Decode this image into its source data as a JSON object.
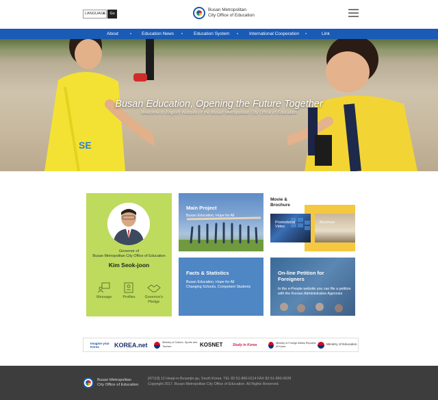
{
  "header": {
    "language_label": "LANGUAGE",
    "go_label": "Go",
    "logo_line1": "Busan Metropolitan",
    "logo_line2": "City Office of Education"
  },
  "nav": {
    "items": [
      {
        "label": "About"
      },
      {
        "label": "Education News"
      },
      {
        "label": "Education System"
      },
      {
        "label": "International Cooperation"
      },
      {
        "label": "Link"
      }
    ]
  },
  "hero": {
    "title": "Busan Education, Opening the Future Together",
    "subtitle": "Welcome to English Website of the Busan Metropolitan City Office of Education"
  },
  "governor": {
    "title_line1": "Governor of",
    "title_line2": "Busan Metropolitan City Office of Education",
    "name": "Kim Seok-joon",
    "links": [
      {
        "label": "Message",
        "icon": "message-icon"
      },
      {
        "label": "Profiles",
        "icon": "profile-icon"
      },
      {
        "label": "Governor's Pledge",
        "icon": "handshake-icon"
      }
    ]
  },
  "cards": {
    "main_project": {
      "title": "Main Project",
      "desc": "Busan Education, Hope for All"
    },
    "facts": {
      "title": "Facts & Statistics",
      "desc_line1": "Busan Education, Hope for All",
      "desc_line2": "Changing Schools, Competent Students"
    },
    "movie": {
      "title_line1": "Movie &",
      "title_line2": "Brochure",
      "promo_label": "Promotional",
      "promo_label2": "Video",
      "brochure_label": "Brochure"
    },
    "petition": {
      "title_line1": "On-line Petition for",
      "title_line2": "Foreigners",
      "desc_line1": "In the e-People website you can file a petition",
      "desc_line2": "with the Korean Administrative Agencies"
    }
  },
  "partners": [
    {
      "label": "Imagine your Korea"
    },
    {
      "label": "KOREA.net"
    },
    {
      "label": "Ministry of Culture, Sports and Tourism"
    },
    {
      "label": "KOSNET"
    },
    {
      "label": "Study in Korea"
    },
    {
      "label": "Ministry of Foreign Affairs Republic of Korea"
    },
    {
      "label": "Ministry of Education"
    }
  ],
  "footer": {
    "logo_line1": "Busan Metropolitan",
    "logo_line2": "City Office of Education",
    "address": "[47119] 12 Hwaji-ro Busanjin-gu, South Korea. TEL 82-51-860-0114 FAX 82-51-860-0628",
    "copyright": "Copyright 2017. Busan Metropolitan City Office of Education. All Rights Reserved."
  }
}
